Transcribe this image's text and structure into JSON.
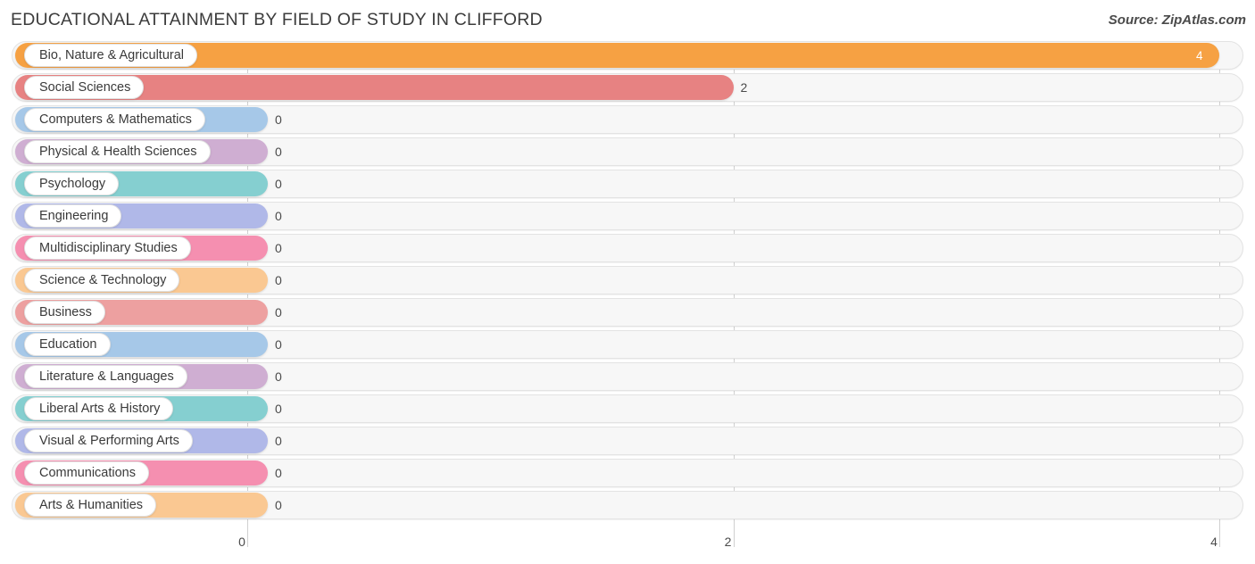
{
  "header": {
    "title": "EDUCATIONAL ATTAINMENT BY FIELD OF STUDY IN CLIFFORD",
    "source": "Source: ZipAtlas.com"
  },
  "chart_data": {
    "type": "bar",
    "orientation": "horizontal",
    "title": "EDUCATIONAL ATTAINMENT BY FIELD OF STUDY IN CLIFFORD",
    "xlabel": "",
    "ylabel": "",
    "xlim": [
      0,
      4
    ],
    "grid": true,
    "legend": "none",
    "xticks": [
      "0",
      "2",
      "4"
    ],
    "xtickvalues": [
      0,
      2,
      4
    ],
    "categories": [
      "Bio, Nature & Agricultural",
      "Social Sciences",
      "Computers & Mathematics",
      "Physical & Health Sciences",
      "Psychology",
      "Engineering",
      "Multidisciplinary Studies",
      "Science & Technology",
      "Business",
      "Education",
      "Literature & Languages",
      "Liberal Arts & History",
      "Visual & Performing Arts",
      "Communications",
      "Arts & Humanities"
    ],
    "values": [
      4,
      2,
      0,
      0,
      0,
      0,
      0,
      0,
      0,
      0,
      0,
      0,
      0,
      0,
      0
    ],
    "value_labels": [
      "4",
      "2",
      "0",
      "0",
      "0",
      "0",
      "0",
      "0",
      "0",
      "0",
      "0",
      "0",
      "0",
      "0",
      "0"
    ],
    "colors": [
      "#f6a143",
      "#e78282",
      "#a6c8e8",
      "#cfaed2",
      "#85cfd0",
      "#b0b8e8",
      "#f58fb0",
      "#fac892",
      "#eda0a0",
      "#a6c8e8",
      "#cfaed2",
      "#85cfd0",
      "#b0b8e8",
      "#f58fb0",
      "#fac892"
    ],
    "bars": [
      {
        "label": "Bio, Nature & Agricultural",
        "value": 4,
        "value_label": "4",
        "color": "#f6a143",
        "label_inside_bar": true
      },
      {
        "label": "Social Sciences",
        "value": 2,
        "value_label": "2",
        "color": "#e78282",
        "label_inside_bar": false
      },
      {
        "label": "Computers & Mathematics",
        "value": 0,
        "value_label": "0",
        "color": "#a6c8e8",
        "label_inside_bar": false
      },
      {
        "label": "Physical & Health Sciences",
        "value": 0,
        "value_label": "0",
        "color": "#cfaed2",
        "label_inside_bar": false
      },
      {
        "label": "Psychology",
        "value": 0,
        "value_label": "0",
        "color": "#85cfd0",
        "label_inside_bar": false
      },
      {
        "label": "Engineering",
        "value": 0,
        "value_label": "0",
        "color": "#b0b8e8",
        "label_inside_bar": false
      },
      {
        "label": "Multidisciplinary Studies",
        "value": 0,
        "value_label": "0",
        "color": "#f58fb0",
        "label_inside_bar": false
      },
      {
        "label": "Science & Technology",
        "value": 0,
        "value_label": "0",
        "color": "#fac892",
        "label_inside_bar": false
      },
      {
        "label": "Business",
        "value": 0,
        "value_label": "0",
        "color": "#eda0a0",
        "label_inside_bar": false
      },
      {
        "label": "Education",
        "value": 0,
        "value_label": "0",
        "color": "#a6c8e8",
        "label_inside_bar": false
      },
      {
        "label": "Literature & Languages",
        "value": 0,
        "value_label": "0",
        "color": "#cfaed2",
        "label_inside_bar": false
      },
      {
        "label": "Liberal Arts & History",
        "value": 0,
        "value_label": "0",
        "color": "#85cfd0",
        "label_inside_bar": false
      },
      {
        "label": "Visual & Performing Arts",
        "value": 0,
        "value_label": "0",
        "color": "#b0b8e8",
        "label_inside_bar": false
      },
      {
        "label": "Communications",
        "value": 0,
        "value_label": "0",
        "color": "#f58fb0",
        "label_inside_bar": false
      },
      {
        "label": "Arts & Humanities",
        "value": 0,
        "value_label": "0",
        "color": "#fac892",
        "label_inside_bar": false
      }
    ]
  }
}
